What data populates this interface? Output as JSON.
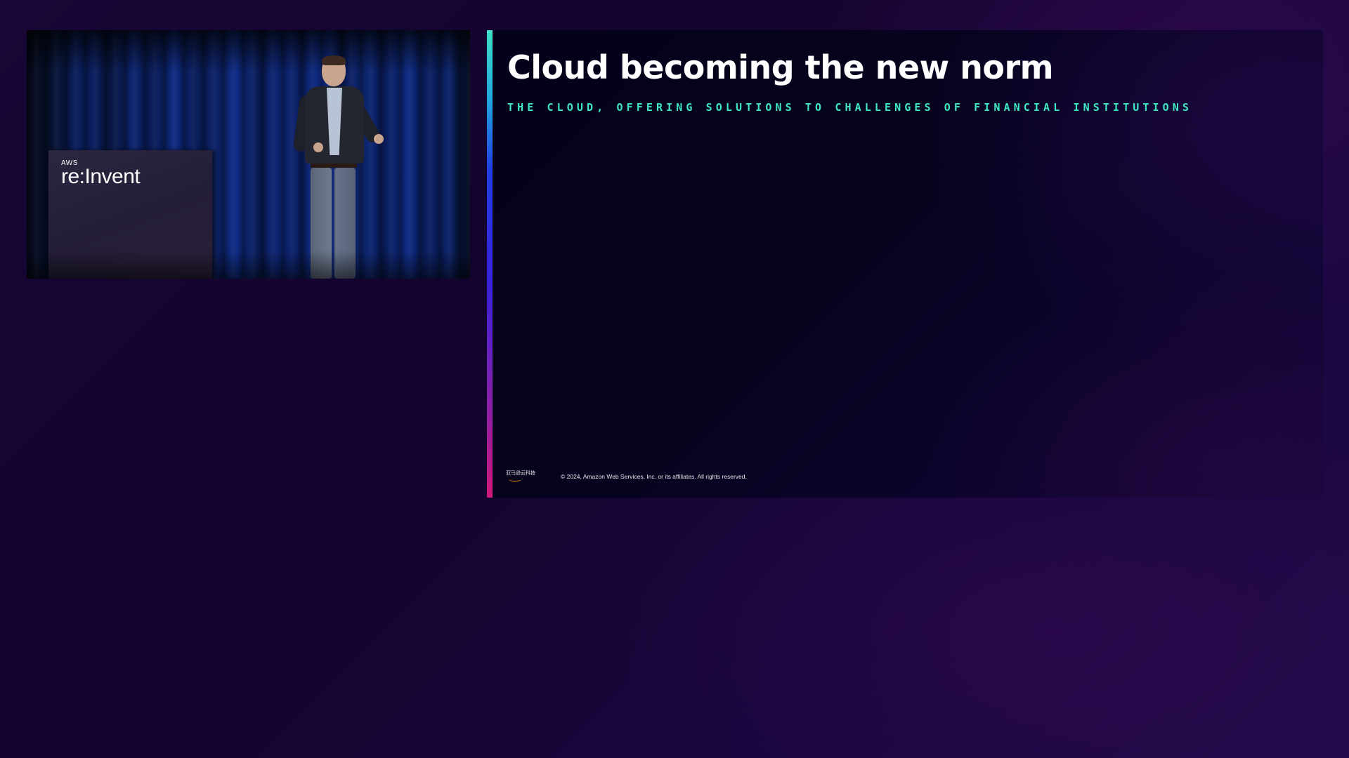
{
  "video": {
    "podium_logo_small": "AWS",
    "podium_logo_main": "re:Invent"
  },
  "slide": {
    "title": "Cloud becoming the new norm",
    "subtitle": "THE CLOUD, OFFERING SOLUTIONS TO CHALLENGES OF FINANCIAL INSTITUTIONS",
    "footer_logo_text": "亚马逊云科技",
    "footer_copyright": "© 2024, Amazon Web Services, Inc. or its affiliates. All rights reserved."
  },
  "colors": {
    "background": "#14082e",
    "slide_background": "#06031e",
    "title": "#ffffff",
    "subtitle_accent": "#3ee8c0",
    "accent_bar_top": "#3fe0c5",
    "accent_bar_middle": "#1f3de0",
    "accent_bar_bottom": "#d0187a",
    "footer_smile": "#ff9900"
  }
}
